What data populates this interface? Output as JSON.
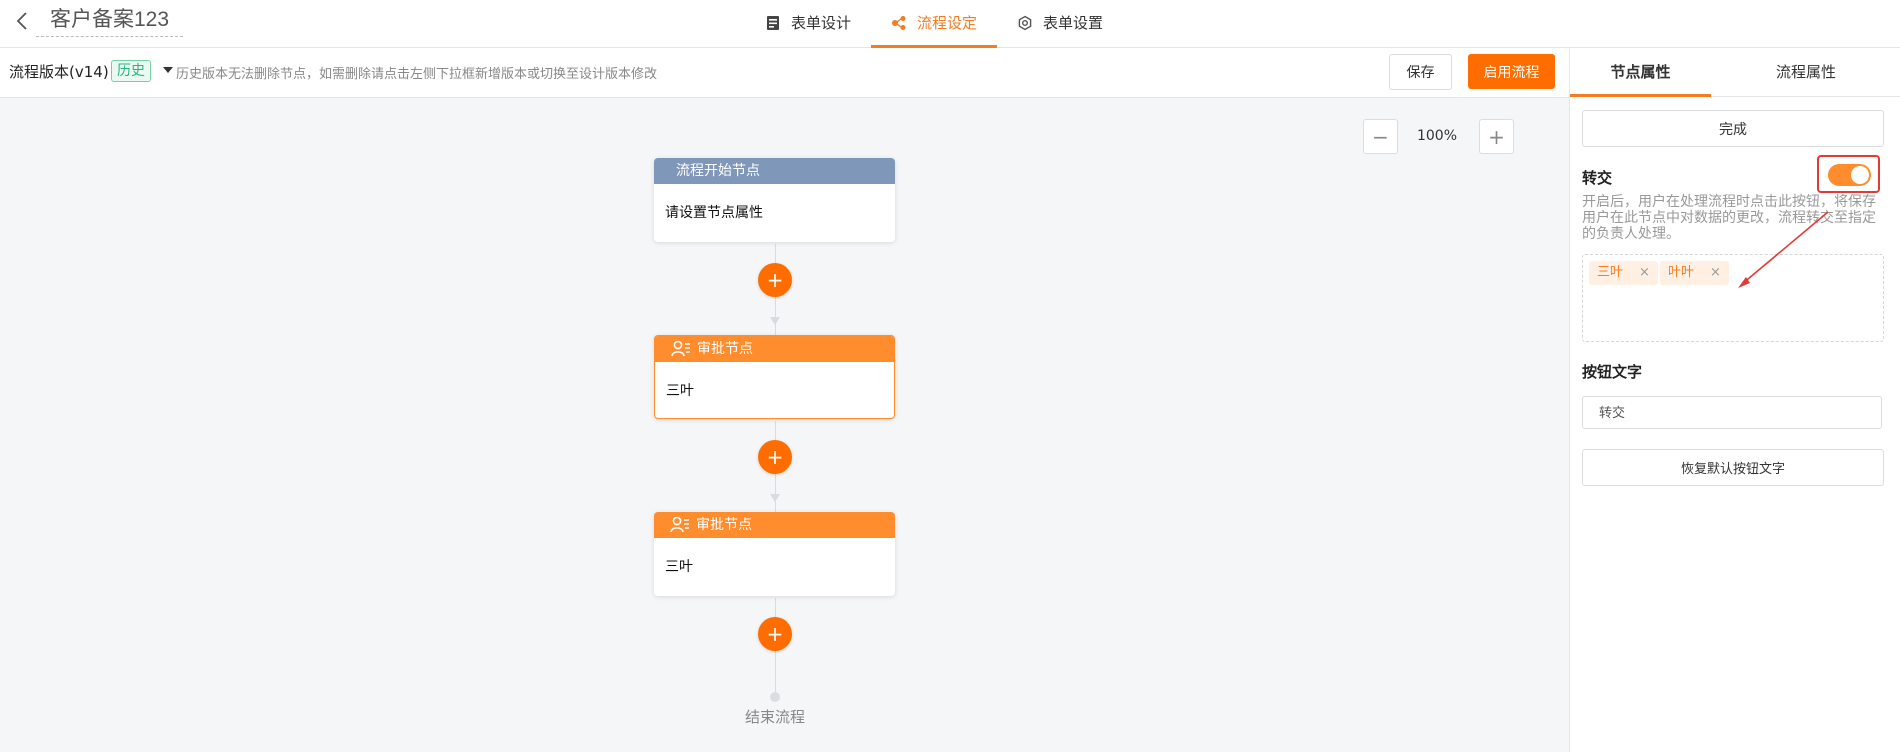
{
  "header": {
    "title": "客户备案123",
    "tabs": [
      {
        "label": "表单设计",
        "icon": "form-icon",
        "active": false
      },
      {
        "label": "流程设定",
        "icon": "flow-icon",
        "active": true
      },
      {
        "label": "表单设置",
        "icon": "gear-icon",
        "active": false
      }
    ]
  },
  "toolbar": {
    "version_label": "流程版本(v14)",
    "version_badge": "历史",
    "hint": "历史版本无法删除节点，如需删除请点击左侧下拉框新增版本或切换至设计版本修改",
    "save_label": "保存",
    "enable_label": "启用流程"
  },
  "canvas": {
    "zoom": "100%",
    "zoom_minus": "−",
    "zoom_plus": "+",
    "add_symbol": "+",
    "nodes": [
      {
        "type": "start",
        "title": "流程开始节点",
        "body": "请设置节点属性"
      },
      {
        "type": "approve",
        "title": "审批节点",
        "body": "三叶",
        "selected": true
      },
      {
        "type": "approve",
        "title": "审批节点",
        "body": "三叶",
        "selected": false
      }
    ],
    "end_label": "结束流程"
  },
  "panel": {
    "tabs": [
      "节点属性",
      "流程属性"
    ],
    "done_label": "完成",
    "transfer": {
      "title": "转交",
      "enabled": true,
      "description": "开启后，用户在处理流程时点击此按钮，将保存用户在此节点中对数据的更改，流程转交至指定的负责人处理。",
      "assignees": [
        "三叶",
        "叶叶"
      ],
      "remove_symbol": "×"
    },
    "button_text": {
      "title": "按钮文字",
      "value": "转交",
      "reset_label": "恢复默认按钮文字"
    }
  },
  "colors": {
    "accent": "#ff6d00",
    "approve_header": "#ff8c2d",
    "start_header": "#7f97b9",
    "annotation": "#e53935"
  }
}
